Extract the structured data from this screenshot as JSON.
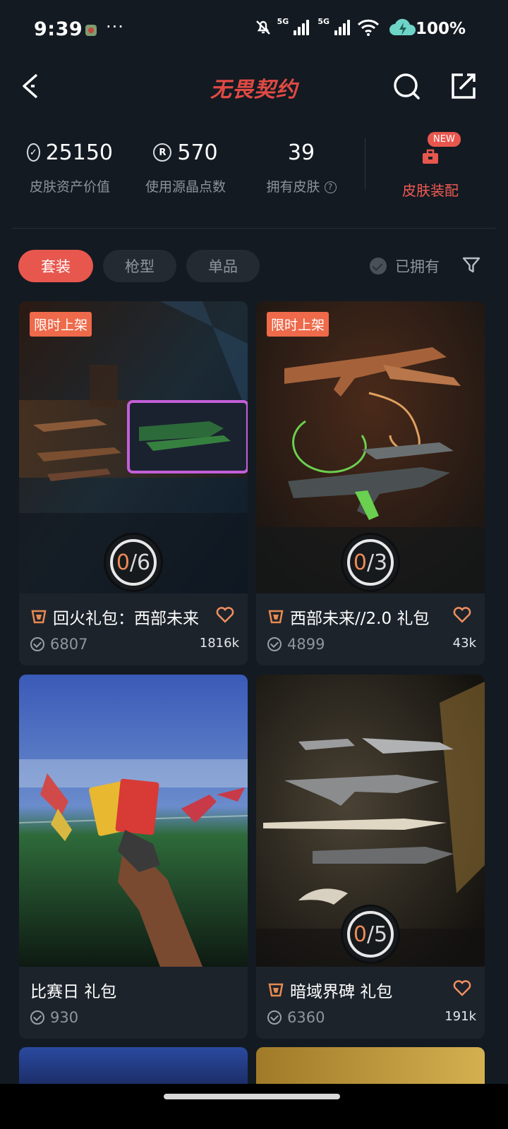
{
  "status_bar": {
    "time": "9:39",
    "more": "···",
    "battery": "100%",
    "network": "5G"
  },
  "header": {
    "logo_text": "无畏契约"
  },
  "stats": [
    {
      "icon": "vp-coin-icon",
      "value": "25150",
      "label": "皮肤资产价值"
    },
    {
      "icon": "radianite-icon",
      "value": "570",
      "label": "使用源晶点数"
    },
    {
      "icon": "",
      "value": "39",
      "label": "拥有皮肤"
    }
  ],
  "equip": {
    "label": "皮肤装配",
    "badge": "NEW"
  },
  "filters": {
    "chips": [
      "套装",
      "枪型",
      "单品"
    ],
    "active": "套装",
    "owned_label": "已拥有"
  },
  "cards": [
    {
      "badge": "限时上架",
      "progress_owned": "0",
      "progress_total": "6",
      "title": "回火礼包：西部未来",
      "price": "6807",
      "likes": "1816k",
      "has_tier": true,
      "has_heart": true
    },
    {
      "badge": "限时上架",
      "progress_owned": "0",
      "progress_total": "3",
      "title": "西部未来//2.0 礼包",
      "price": "4899",
      "likes": "43k",
      "has_tier": true,
      "has_heart": true
    },
    {
      "badge": "",
      "progress_owned": "",
      "progress_total": "",
      "title": "比赛日 礼包",
      "price": "930",
      "likes": "",
      "has_tier": false,
      "has_heart": false
    },
    {
      "badge": "",
      "progress_owned": "0",
      "progress_total": "5",
      "title": "暗域界碑 礼包",
      "price": "6360",
      "likes": "191k",
      "has_tier": true,
      "has_heart": true
    }
  ],
  "colors": {
    "accent": "#e8574e",
    "background": "#131a22",
    "card": "#1c232b",
    "muted": "#8f959c"
  }
}
